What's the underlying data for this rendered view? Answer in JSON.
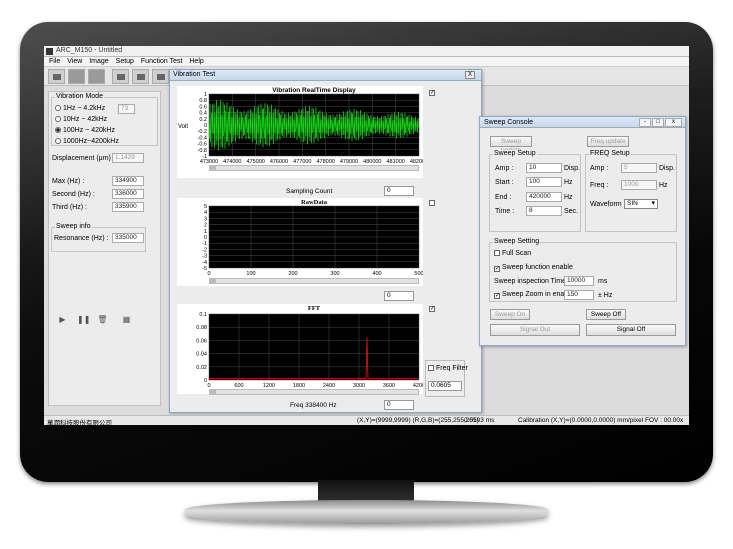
{
  "app": {
    "title": "ARC_M150 - Untitled"
  },
  "menu": [
    "File",
    "View",
    "Image",
    "Setup",
    "Function Test",
    "Help"
  ],
  "left_panel": {
    "vibration_mode": {
      "label": "Vibration Mode",
      "options": [
        "1Hz ~ 4.2kHz",
        "10Hz ~ 42kHz",
        "100Hz ~ 420kHz",
        "1000Hz~4200kHz"
      ],
      "selected_index": 2,
      "value": "73"
    },
    "displacement": {
      "label": "Displacement (μm) :",
      "value": "1.1429"
    },
    "max": {
      "label": "Max (Hz) :",
      "value": "334900"
    },
    "second": {
      "label": "Second (Hz) :",
      "value": "336000"
    },
    "third": {
      "label": "Third (Hz) :",
      "value": "335900"
    },
    "sweep_info": {
      "label": "Sweep info",
      "resonance_label": "Resonance (Hz) :",
      "resonance_value": "335000"
    },
    "controls": {
      "play": "▶",
      "pause": "❚❚",
      "delete": "🗑",
      "grid": "▦"
    }
  },
  "vibration_test": {
    "title": "Vibration Test",
    "close": "X",
    "realtime": {
      "title": "Vibration RealTime Display",
      "ylabel": "Volt",
      "xlabel": "Sampling Count",
      "value": "0",
      "checked": "✓",
      "yticks": [
        "1",
        "0.8",
        "0.6",
        "0.4",
        "0.2",
        "0",
        "-0.2",
        "-0.4",
        "-0.6",
        "-0.8",
        "-1"
      ],
      "xticks": [
        "473000",
        "474000",
        "475000",
        "476000",
        "477000",
        "478000",
        "479000",
        "480000",
        "481000",
        "482000"
      ]
    },
    "rawdata": {
      "title": "RawData",
      "value": "0",
      "yticks": [
        "5",
        "4",
        "3",
        "2",
        "1",
        "0",
        "-1",
        "-2",
        "-3",
        "-4",
        "-5"
      ],
      "xticks": [
        "0",
        "100",
        "200",
        "300",
        "400",
        "500"
      ]
    },
    "fft": {
      "title": "FFT",
      "freq_label": "Freq 338400   Hz",
      "value": "0",
      "checked": "✓",
      "filter_label": "Freq Filter",
      "filter_value": "0.0605",
      "yticks": [
        "0.1",
        "0.08",
        "0.06",
        "0.04",
        "0.02",
        "0"
      ],
      "xticks": [
        "0",
        "600",
        "1200",
        "1800",
        "2400",
        "3000",
        "3600",
        "4200"
      ]
    }
  },
  "sweep_console": {
    "title": "Sweep Console",
    "sweep_update": "Sweep update",
    "freq_update": "Freq update",
    "sweep_setup": {
      "label": "Sweep Setup",
      "amp_label": "Amp :",
      "amp_value": "10",
      "amp_unit": "Disp.",
      "start_label": "Start :",
      "start_value": "100",
      "start_unit": "Hz",
      "end_label": "End :",
      "end_value": "420000",
      "end_unit": "Hz",
      "time_label": "Time :",
      "time_value": "8",
      "time_unit": "Sec."
    },
    "freq_setup": {
      "label": "FREQ Setup",
      "amp_label": "Amp :",
      "amp_value": "5",
      "amp_unit": "Disp.",
      "freq_label": "Freq :",
      "freq_value": "1000",
      "freq_unit": "Hz",
      "waveform_label": "Waveform :",
      "waveform_value": "SIN"
    },
    "sweep_setting": {
      "label": "Sweep Setting",
      "full_scan": "Full Scan",
      "enable": "Sweep function enable",
      "inspection_label": "Sweep inspection Time :",
      "inspection_value": "10000",
      "inspection_unit": "ms",
      "zoom_label": "Sweep Zoom in enable :",
      "zoom_value": "150",
      "zoom_unit": "± Hz"
    },
    "sweep_on": "Sweep On",
    "sweep_off": "Sweep Off",
    "signal_out": "Signal Out",
    "signal_off": "Signal Off"
  },
  "status": {
    "company": "萬潤科技股份有限公司",
    "xy": "(X,Y)=(9999,9999) (R,G,B)=(255,255,255)",
    "ms": "0.0103 ms",
    "calibration": "Calibration (X,Y)=(0.0000,0.0000) mm/pixel   FOV : 00.00x"
  },
  "colors": {
    "signal_green": "#19e619",
    "fft_red": "#ff1a1a",
    "plot_bg": "#000000"
  }
}
